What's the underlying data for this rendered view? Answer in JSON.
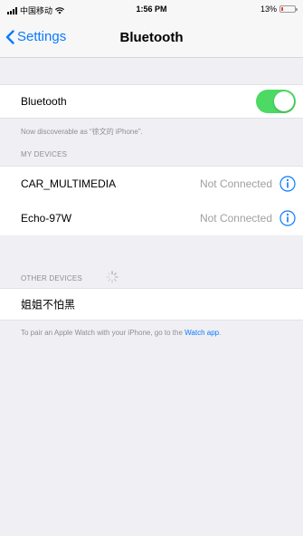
{
  "status_bar": {
    "carrier": "中国移动",
    "time": "1:56 PM",
    "battery": "13%",
    "battery_level": 0.13,
    "battery_color": "#ff3b30"
  },
  "nav": {
    "back_label": "Settings",
    "title": "Bluetooth"
  },
  "bluetooth": {
    "label": "Bluetooth",
    "enabled": true,
    "toggle_color": "#4cd964",
    "discoverable_note": "Now discoverable as “徐文的 iPhone”."
  },
  "my_devices": {
    "header": "MY DEVICES",
    "items": [
      {
        "name": "CAR_MULTIMEDIA",
        "status": "Not Connected",
        "icon": "info-icon"
      },
      {
        "name": "Echo-97W",
        "status": "Not Connected",
        "icon": "info-icon"
      }
    ]
  },
  "other_devices": {
    "header": "OTHER DEVICES",
    "items": [
      {
        "name": "姐姐不怕黑"
      }
    ]
  },
  "pair_note": {
    "text": "To pair an Apple Watch with your iPhone, go to the ",
    "link": "Watch app",
    "end": "."
  },
  "accent_color": "#0a7aff"
}
